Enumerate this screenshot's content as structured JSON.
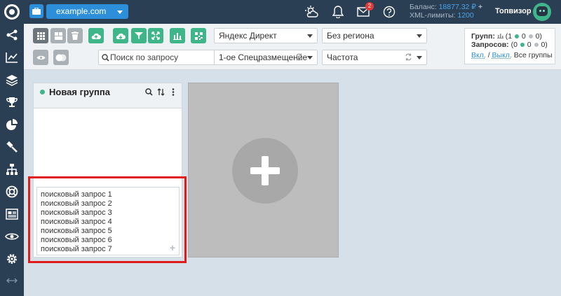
{
  "topbar": {
    "domain": "example.com",
    "mail_badge": "2",
    "balance_label": "Баланс:",
    "balance_value": "18877.32 ₽",
    "xml_label": "XML-лимиты:",
    "xml_value": "1200",
    "username": "Топвизор"
  },
  "toolbar": {
    "search_placeholder": "Поиск по запросу",
    "engine_select": "Яндекс Директ",
    "region_select": "Без региона",
    "position_select": "1-ое Спецразмещение",
    "frequency_select": "Частота"
  },
  "stats": {
    "groups_label": "Групп:",
    "groups_total": "(1",
    "groups_active": "0",
    "groups_inactive": "0)",
    "queries_label": "Запросов:",
    "queries_total": "(0",
    "queries_active": "0",
    "queries_inactive": "0)",
    "on_link": "Вкл.",
    "separator": "/",
    "off_link": "Выкл.",
    "all_groups": "Все группы"
  },
  "group": {
    "title": "Новая группа",
    "queries": [
      "поисковый запрос 1",
      "поисковый запрос 2",
      "поисковый запрос 3",
      "поисковый запрос 4",
      "поисковый запрос 5",
      "поисковый запрос 6",
      "поисковый запрос 7"
    ]
  },
  "colors": {
    "topbar": "#2a3f54",
    "accent_blue": "#2d8fd9",
    "accent_green": "#3fb58a",
    "highlight": "#e01b1b"
  },
  "icons": {
    "sidebar": [
      "share-icon",
      "chart-icon",
      "layers-icon",
      "trophy-icon",
      "pie-icon",
      "hammer-icon",
      "sitemap-icon",
      "lifebuoy-icon",
      "newspaper-icon",
      "eye-icon",
      "gear-icon",
      "collapse-arrows-icon"
    ]
  }
}
